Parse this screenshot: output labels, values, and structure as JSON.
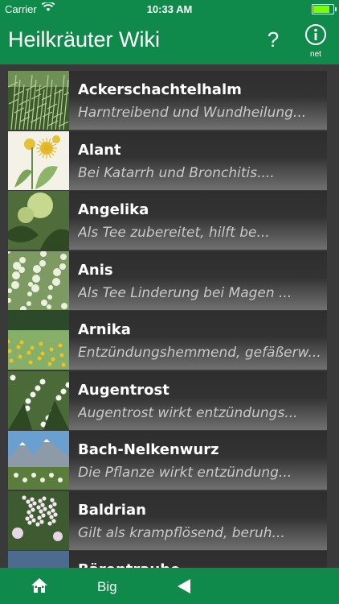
{
  "status_bar": {
    "carrier": "Carrier",
    "time": "10:33 AM",
    "battery_level": 0.85
  },
  "nav": {
    "title": "Heilkräuter Wiki",
    "help_label": "?",
    "info_sub_label": "net"
  },
  "list": {
    "items": [
      {
        "name": "Ackerschachtelhalm",
        "desc": "Harntreibend und Wundheilung...",
        "thumb": "horsetail"
      },
      {
        "name": "Alant",
        "desc": "Bei Katarrh und Bronchitis....",
        "thumb": "illustration"
      },
      {
        "name": "Angelika",
        "desc": "Als Tee zubereitet, hilft be...",
        "thumb": "angelica"
      },
      {
        "name": "Anis",
        "desc": "Als Tee Linderung bei Magen ...",
        "thumb": "anise"
      },
      {
        "name": "Arnika",
        "desc": "Entzündungshemmend, gefäßerw...",
        "thumb": "arnica"
      },
      {
        "name": "Augentrost",
        "desc": "Augentrost wirkt entzündungs...",
        "thumb": "eyebright"
      },
      {
        "name": "Bach-Nelkenwurz",
        "desc": "Die Pflanze wirkt entzündung...",
        "thumb": "mountain"
      },
      {
        "name": "Baldrian",
        "desc": "Gilt als krampflösend, beruh...",
        "thumb": "valerian"
      },
      {
        "name": "Bärentraube",
        "desc": "",
        "thumb": "bearberry"
      }
    ]
  },
  "tab_bar": {
    "big_label": "Big",
    "home_icon": "home-icon",
    "back_icon": "back-triangle-icon"
  },
  "colors": {
    "primary_green": "#0f8a4a",
    "background": "#3a3a3a",
    "text_white": "#ffffff",
    "desc_gray": "#c9c9c9"
  }
}
